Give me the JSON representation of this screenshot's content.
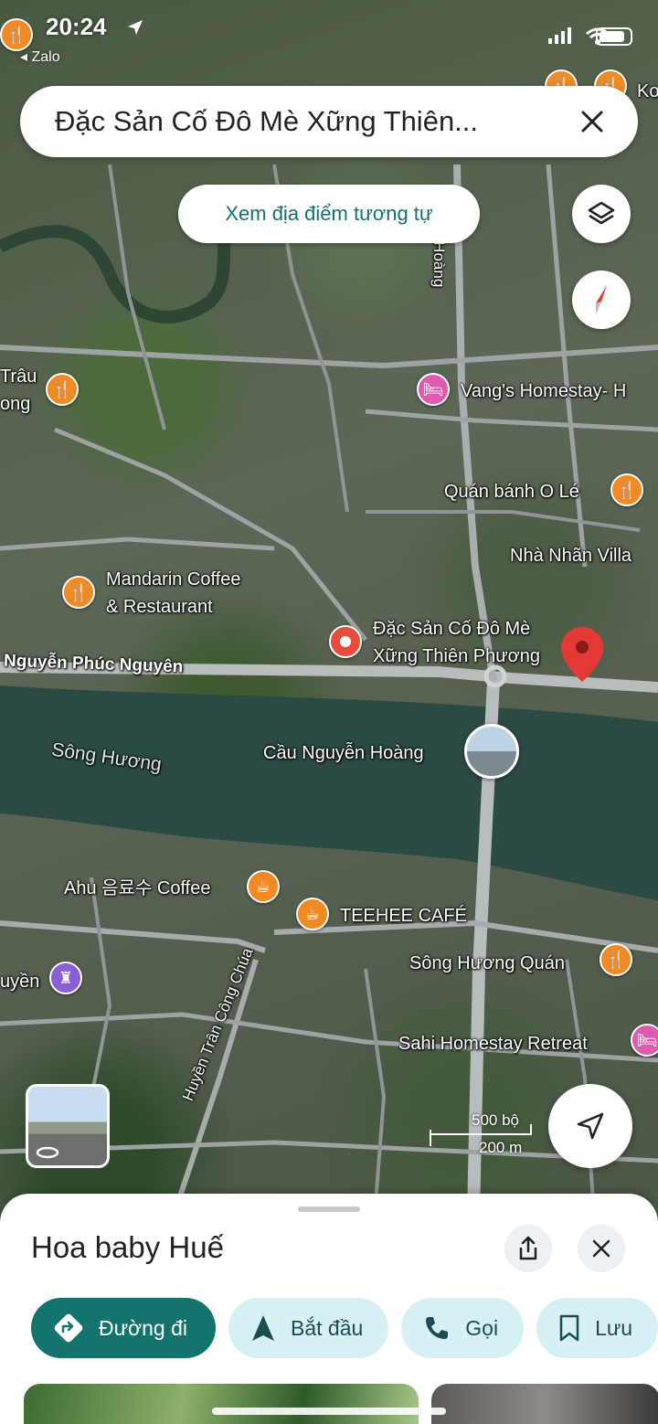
{
  "status_bar": {
    "time": "20:24",
    "back_app": "Zalo"
  },
  "search": {
    "title": "Đặc Sản Cố Đô Mè Xững Thiên..."
  },
  "similar_button": {
    "label": "Xem địa điểm tương tự"
  },
  "map": {
    "labels": {
      "trau": "Trâu",
      "ong": "ong",
      "vangs_homestay": "Vang's Homestay- H",
      "quan_banh_o_le": "Quán bánh O Lé",
      "nha_nhan_villa": "Nhà Nhãn Villa",
      "mandarin_line1": "Mandarin Coffee",
      "mandarin_line2": "& Restaurant",
      "dac_san_line1": "Đặc Sản Cố Đô Mè",
      "dac_san_line2": "Xững Thiên Phương",
      "nguyen_phuc_nguyen": "Nguyễn Phúc Nguyên",
      "song_huong": "Sông Hương",
      "cau_nguyen_hoang": "Cầu Nguyễn Hoàng",
      "ahu_coffee": "Ahu 음료수 Coffee",
      "teehee_cafe": "TEEHEE CAFÉ",
      "song_huong_quan": "Sông Hương Quán",
      "sahi_homestay": "Sahi Homestay Retreat",
      "huyen_tran_cong_chua": "Huyền Trân Công Chúa",
      "uyen": "uyền",
      "top_road": "n Hoàng",
      "ko": "Ko"
    },
    "scale": {
      "feet": "500 bộ",
      "meters": "200 m"
    }
  },
  "place": {
    "title": "Hoa baby Huế",
    "actions": {
      "directions": "Đường đi",
      "start": "Bắt đầu",
      "call": "Gọi",
      "save": "Lưu"
    }
  },
  "colors": {
    "accent": "#13736d",
    "chip_bg": "#d7f0f3",
    "pin": "#e74c3c",
    "poi_food": "#f08a24"
  }
}
